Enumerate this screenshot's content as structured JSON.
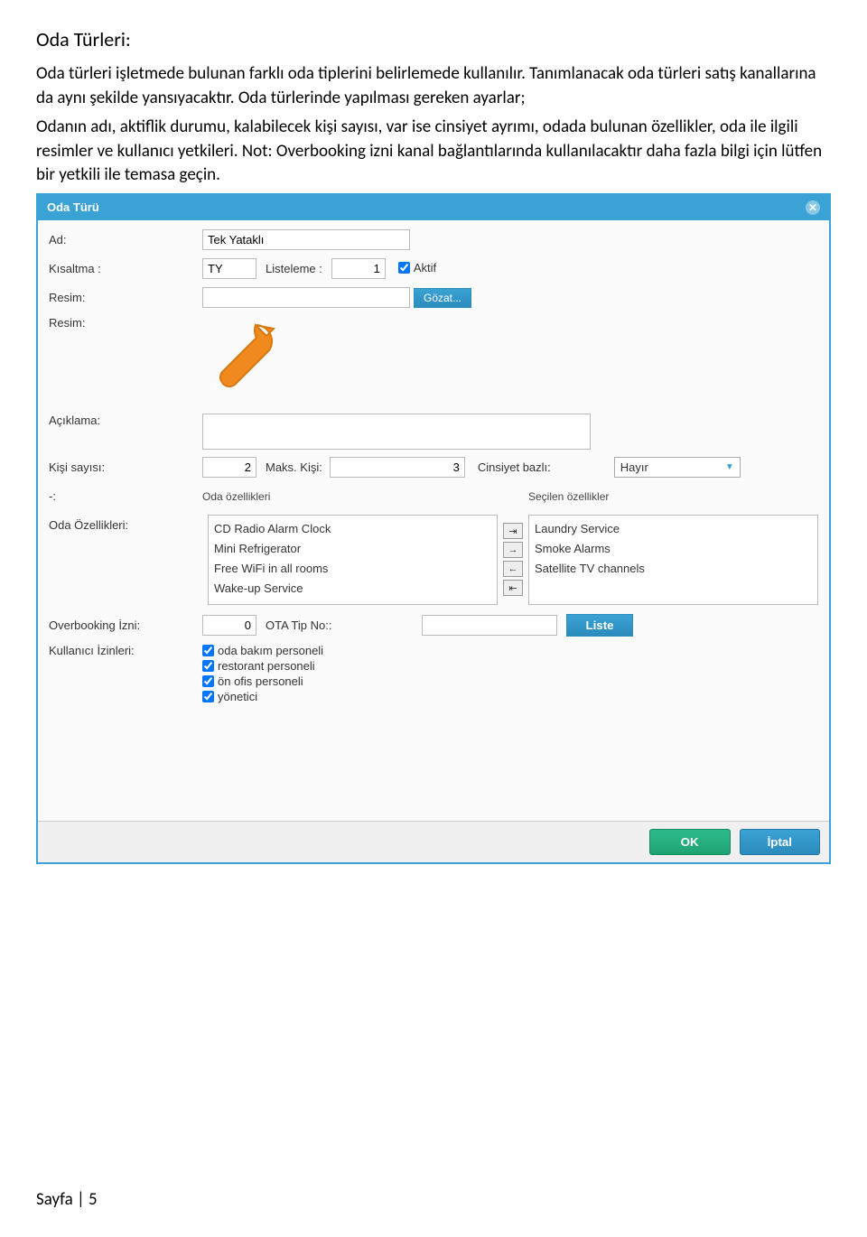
{
  "doc": {
    "heading": "Oda Türleri:",
    "para1": "Oda türleri işletmede bulunan farklı oda tiplerini belirlemede kullanılır. Tanımlanacak oda türleri satış kanallarına da aynı şekilde yansıyacaktır. Oda türlerinde yapılması gereken ayarlar;",
    "para2": "Odanın adı, aktiflik durumu, kalabilecek kişi sayısı, var ise cinsiyet ayrımı, odada bulunan özellikler, oda ile ilgili resimler ve kullanıcı yetkileri.  Not:  Overbooking izni kanal bağlantılarında kullanılacaktır daha fazla bilgi için lütfen bir yetkili ile temasa geçin.",
    "footer": "Sayfa | 5"
  },
  "modal": {
    "title": "Oda Türü",
    "labels": {
      "ad": "Ad:",
      "kisaltma": "Kısaltma :",
      "listeleme": "Listeleme :",
      "aktif": "Aktif",
      "resim": "Resim:",
      "gozat": "Gözat...",
      "aciklama": "Açıklama:",
      "kisi_sayisi": "Kişi sayısı:",
      "maks_kisi": "Maks. Kişi:",
      "cinsiyet": "Cinsiyet bazlı:",
      "dash": "-:",
      "oda_ozellikleri_hdr": "Oda özellikleri",
      "secilen_hdr": "Seçilen özellikler",
      "oda_ozellikleri": "Oda Özellikleri:",
      "overbooking": "Overbooking İzni:",
      "ota": "OTA Tip No::",
      "liste": "Liste",
      "kullanici": "Kullanıcı İzinleri:",
      "ok": "OK",
      "iptal": "İptal"
    },
    "values": {
      "ad": "Tek Yataklı",
      "kisaltma": "TY",
      "listeleme": "1",
      "kisi_sayisi": "2",
      "maks_kisi": "3",
      "cinsiyet": "Hayır",
      "overbooking": "0",
      "ota": ""
    },
    "available_features": [
      "CD Radio Alarm Clock",
      "Mini Refrigerator",
      "Free WiFi in all rooms",
      "Wake-up Service"
    ],
    "selected_features": [
      "Laundry Service",
      "Smoke Alarms",
      "Satellite TV channels"
    ],
    "permissions": [
      "oda bakım personeli",
      "restorant personeli",
      "ön ofis personeli",
      "yönetici"
    ]
  }
}
